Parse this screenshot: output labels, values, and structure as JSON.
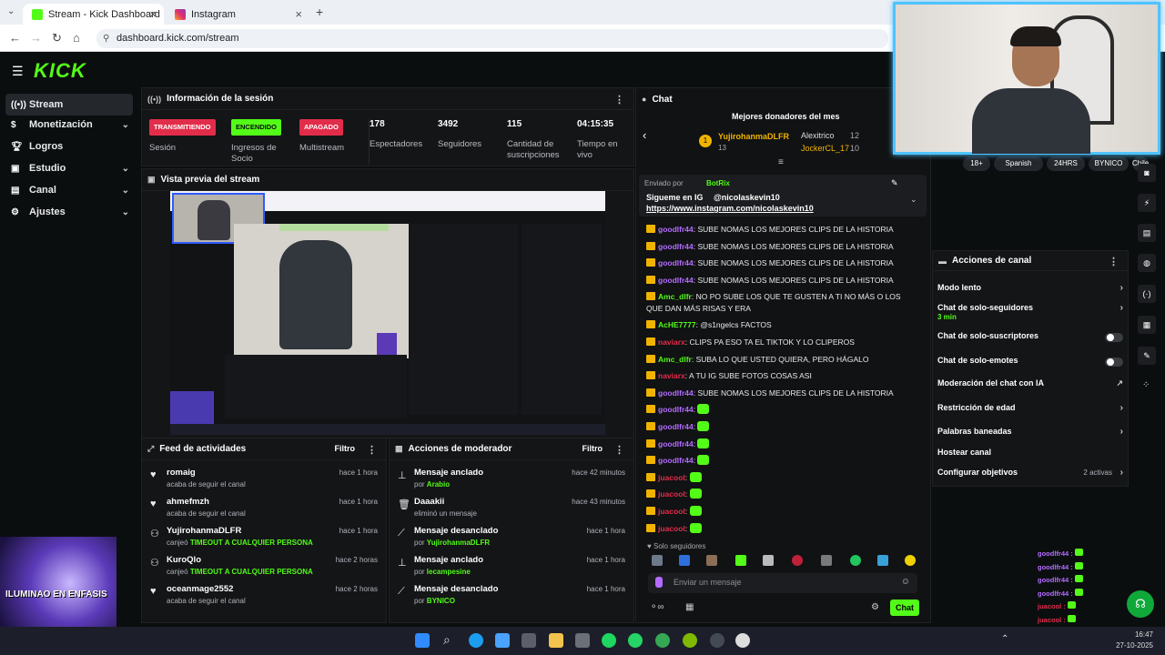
{
  "browser": {
    "tabs": [
      {
        "label": "Stream - Kick Dashboard",
        "favicon": "kick-favicon-icon"
      },
      {
        "label": "Instagram",
        "favicon": "instagram-favicon-icon"
      }
    ],
    "url": "dashboard.kick.com/stream"
  },
  "app": {
    "logo": "KICK"
  },
  "sidebar": {
    "items": [
      {
        "label": "Stream",
        "icon": "broadcast-icon",
        "active": true,
        "expandable": false
      },
      {
        "label": "Monetización",
        "icon": "dollar-icon",
        "active": false,
        "expandable": true
      },
      {
        "label": "Logros",
        "icon": "trophy-icon",
        "active": false,
        "expandable": false
      },
      {
        "label": "Estudio",
        "icon": "studio-icon",
        "active": false,
        "expandable": true
      },
      {
        "label": "Canal",
        "icon": "channel-icon",
        "active": false,
        "expandable": true
      },
      {
        "label": "Ajustes",
        "icon": "gear-icon",
        "active": false,
        "expandable": true
      }
    ]
  },
  "session": {
    "title": "Información de la sesión",
    "cells": [
      {
        "badge": "TRANSMITIENDO",
        "label": "Sesión",
        "tone": "red"
      },
      {
        "badge": "ENCENDIDO",
        "label": "Ingresos de Socio",
        "tone": "green"
      },
      {
        "badge": "APAGADO",
        "label": "Multistream",
        "tone": "red"
      }
    ],
    "stats": [
      {
        "value": "178",
        "label": "Espectadores"
      },
      {
        "value": "3492",
        "label": "Seguidores"
      },
      {
        "value": "115",
        "label": "Cantidad de suscripciones"
      },
      {
        "value": "04:15:35",
        "label": "Tiempo en vivo"
      }
    ]
  },
  "preview": {
    "title": "Vista previa del stream"
  },
  "activity": {
    "title": "Feed de actividades",
    "filter": "Filtro",
    "items": [
      {
        "user": "romaig",
        "text": "acaba de seguir el canal",
        "time": "hace 1 hora",
        "icon": "heart-icon",
        "highlight": ""
      },
      {
        "user": "ahmefmzh",
        "text": "acaba de seguir el canal",
        "time": "hace 1 hora",
        "icon": "heart-icon",
        "highlight": ""
      },
      {
        "user": "YujirohanmaDLFR",
        "text": "canjeó",
        "time": "hace 1 hora",
        "icon": "reward-icon",
        "highlight": "TIMEOUT A CUALQUIER PERSONA"
      },
      {
        "user": "KuroQlo",
        "text": "canjeó",
        "time": "hace 2 horas",
        "icon": "reward-icon",
        "highlight": "TIMEOUT A CUALQUIER PERSONA"
      },
      {
        "user": "oceanmage2552",
        "text": "acaba de seguir el canal",
        "time": "hace 2 horas",
        "icon": "heart-icon",
        "highlight": ""
      }
    ]
  },
  "modactions": {
    "title": "Acciones de moderador",
    "filter": "Filtro",
    "items": [
      {
        "title": "Mensaje anclado",
        "by": "por",
        "who": "Arabio",
        "time": "hace 42 minutos",
        "icon": "pin-icon"
      },
      {
        "title": "Daaakii",
        "by": "eliminó un mensaje",
        "who": "",
        "time": "hace 43 minutos",
        "icon": "trash-icon"
      },
      {
        "title": "Mensaje desanclado",
        "by": "por",
        "who": "YujirohanmaDLFR",
        "time": "hace 1 hora",
        "icon": "unpin-icon"
      },
      {
        "title": "Mensaje anclado",
        "by": "por",
        "who": "lecampesine",
        "time": "hace 1 hora",
        "icon": "pin-icon"
      },
      {
        "title": "Mensaje desanclado",
        "by": "por",
        "who": "BYNICO",
        "time": "hace 1 hora",
        "icon": "unpin-icon"
      }
    ]
  },
  "chat": {
    "title": "Chat",
    "donors_title": "Mejores donadores del mes",
    "donors": [
      {
        "rank": "1",
        "name": "YujirohanmaDLFR",
        "amount": "13"
      },
      {
        "rank": "",
        "name": "Alexitrico",
        "amount": "12"
      },
      {
        "rank": "",
        "name": "JockerCL_17",
        "amount": "10"
      }
    ],
    "pinned": {
      "sent_by": "Enviado por",
      "bot": "BotRix",
      "text": "Siguemе en IG",
      "handle": "@nicolaskevin10",
      "link": "https://www.instagram.com/nicolaskevin10"
    },
    "messages": [
      {
        "user": "goodlfr44",
        "text": "SUBE NOMAS LOS MEJORES CLIPS DE LA HISTORIA",
        "color": "#b36cff"
      },
      {
        "user": "goodlfr44",
        "text": "SUBE NOMAS LOS MEJORES CLIPS DE LA HISTORIA",
        "color": "#b36cff"
      },
      {
        "user": "goodlfr44",
        "text": "SUBE NOMAS LOS MEJORES CLIPS DE LA HISTORIA",
        "color": "#b36cff"
      },
      {
        "user": "goodlfr44",
        "text": "SUBE NOMAS LOS MEJORES CLIPS DE LA HISTORIA",
        "color": "#b36cff"
      },
      {
        "user": "Amc_dlfr",
        "text": "NO PO SUBE LOS QUE TE GUSTEN A TI NO MÁS O LOS QUE DAN MÁS RISAS Y ERA",
        "color": "#53fc18"
      },
      {
        "user": "AcHE7777",
        "text": "@s1ngelcs FACTOS",
        "color": "#53fc18"
      },
      {
        "user": "naviarx",
        "text": "CLIPS PA ESO TA EL TIKTOK Y LO CLIPEROS",
        "color": "#e22d4a"
      },
      {
        "user": "Amc_dlfr",
        "text": "SUBA LO QUE USTED QUIERA, PERO HÁGALO",
        "color": "#53fc18"
      },
      {
        "user": "naviarx",
        "text": "A TU IG SUBE FOTOS COSAS ASI",
        "color": "#e22d4a"
      },
      {
        "user": "goodlfr44",
        "text": "SUBE NOMAS LOS MEJORES CLIPS DE LA HISTORIA",
        "color": "#b36cff"
      },
      {
        "user": "goodlfr44",
        "text": "",
        "color": "#b36cff"
      },
      {
        "user": "goodlfr44",
        "text": "",
        "color": "#b36cff"
      },
      {
        "user": "goodlfr44",
        "text": "",
        "color": "#b36cff"
      },
      {
        "user": "goodlfr44",
        "text": "",
        "color": "#b36cff"
      },
      {
        "user": "juacool",
        "text": "",
        "color": "#e22d4a"
      },
      {
        "user": "juacool",
        "text": "",
        "color": "#e22d4a"
      },
      {
        "user": "juacool",
        "text": "",
        "color": "#e22d4a"
      },
      {
        "user": "juacool",
        "text": "",
        "color": "#e22d4a"
      }
    ],
    "mode": "Solo seguidores",
    "input_placeholder": "Enviar un mensaje",
    "send": "Chat"
  },
  "tags": [
    "18+",
    "Spanish",
    "24HRS",
    "BYNICO",
    "Chile"
  ],
  "channel_actions": {
    "title": "Acciones de canal",
    "items": [
      {
        "label": "Modo lento",
        "sub": "",
        "control": "arrow"
      },
      {
        "label": "Chat de solo-seguidores",
        "sub": "3 min",
        "control": "arrow"
      },
      {
        "label": "Chat de solo-suscriptores",
        "sub": "",
        "control": "toggle"
      },
      {
        "label": "Chat de solo-emotes",
        "sub": "",
        "control": "toggle"
      },
      {
        "label": "Moderación del chat con IA",
        "sub": "",
        "control": "external"
      },
      {
        "label": "Restricción de edad",
        "sub": "",
        "control": "arrow"
      },
      {
        "label": "Palabras baneadas",
        "sub": "",
        "control": "arrow"
      },
      {
        "label": "Hostear canal",
        "sub": "",
        "control": "none"
      },
      {
        "label": "Configurar objetivos",
        "sub": "2 activas",
        "control": "arrow"
      }
    ]
  },
  "overlay": {
    "caption": "ILUMINAO EN ENFASIS"
  },
  "taskbar": {
    "time": "16:47",
    "date": "27-10-2025"
  },
  "colors": {
    "accent": "#53fc18",
    "live": "#e22d4a",
    "bg": "#0b0e0f",
    "panel": "#141517"
  }
}
